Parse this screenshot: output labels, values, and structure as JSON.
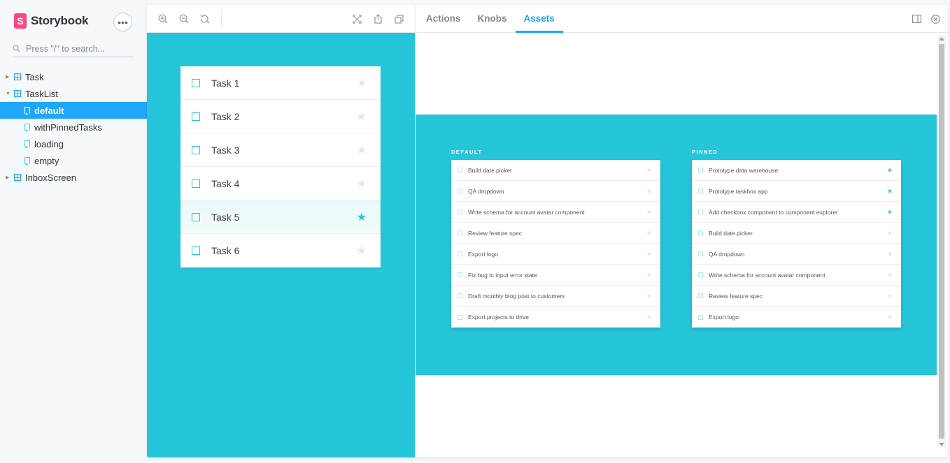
{
  "sidebar": {
    "brand": "Storybook",
    "brand_logo_letter": "S",
    "menu_icon": "•••",
    "search_placeholder": "Press \"/\" to search...",
    "items": [
      {
        "label": "Task",
        "type": "component",
        "expanded": false
      },
      {
        "label": "TaskList",
        "type": "component",
        "expanded": true
      },
      {
        "label": "default",
        "type": "story",
        "selected": true
      },
      {
        "label": "withPinnedTasks",
        "type": "story"
      },
      {
        "label": "loading",
        "type": "story"
      },
      {
        "label": "empty",
        "type": "story"
      },
      {
        "label": "InboxScreen",
        "type": "component",
        "expanded": false
      }
    ]
  },
  "toolbar": {
    "icons": [
      "zoom-in-icon",
      "zoom-out-icon",
      "zoom-reset-icon",
      "fullscreen-icon",
      "share-icon",
      "copy-icon"
    ]
  },
  "preview": {
    "tasks": [
      {
        "title": "Task 1",
        "pinned": false
      },
      {
        "title": "Task 2",
        "pinned": false
      },
      {
        "title": "Task 3",
        "pinned": false
      },
      {
        "title": "Task 4",
        "pinned": false
      },
      {
        "title": "Task 5",
        "pinned": true
      },
      {
        "title": "Task 6",
        "pinned": false
      }
    ]
  },
  "addons": {
    "tabs": [
      {
        "label": "Actions",
        "active": false
      },
      {
        "label": "Knobs",
        "active": false
      },
      {
        "label": "Assets",
        "active": true
      }
    ]
  },
  "asset": {
    "default": {
      "heading": "DEFAULT",
      "tasks": [
        {
          "title": "Build date picker",
          "pinned": false
        },
        {
          "title": "QA dropdown",
          "pinned": false
        },
        {
          "title": "Write schema for account avatar component",
          "pinned": false
        },
        {
          "title": "Review feature spec",
          "pinned": false
        },
        {
          "title": "Export logo",
          "pinned": false
        },
        {
          "title": "Fix bug in input error state",
          "pinned": false
        },
        {
          "title": "Draft monthly blog post to customers",
          "pinned": false
        },
        {
          "title": "Export projects to drive",
          "pinned": false
        }
      ]
    },
    "pinned": {
      "heading": "PINNED",
      "tasks": [
        {
          "title": "Prototype data warehouse",
          "pinned": true
        },
        {
          "title": "Prototype taskbox app",
          "pinned": true
        },
        {
          "title": "Add checkbox component to component explorer",
          "pinned": true
        },
        {
          "title": "Build date picker",
          "pinned": false
        },
        {
          "title": "QA dropdown",
          "pinned": false
        },
        {
          "title": "Write schema for account avatar component",
          "pinned": false
        },
        {
          "title": "Review feature spec",
          "pinned": false
        },
        {
          "title": "Export logo",
          "pinned": false
        }
      ]
    }
  },
  "colors": {
    "accent": "#1ea7fd",
    "brand": "#ff4785",
    "preview_bg": "#26c6da"
  }
}
